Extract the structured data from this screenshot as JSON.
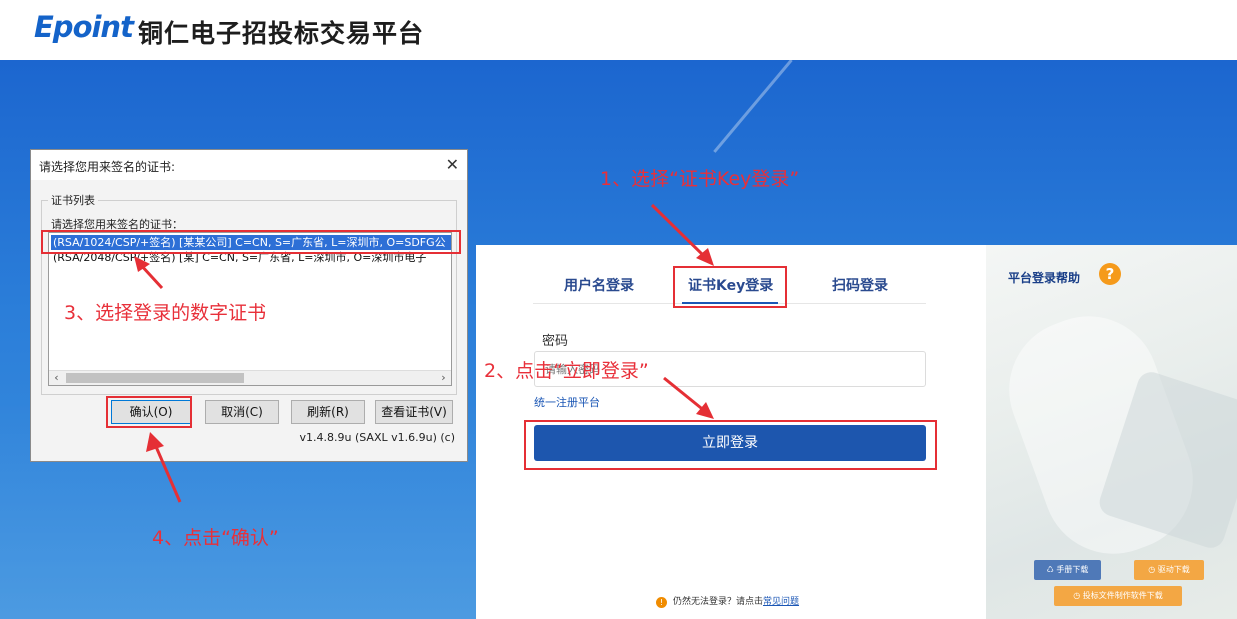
{
  "header": {
    "logo": "Epoint",
    "site_title": "铜仁电子招投标交易平台"
  },
  "cert_dialog": {
    "title": "请选择您用来签名的证书:",
    "group_label": "证书列表",
    "hint": "请选择您用来签名的证书：",
    "certificates": [
      "(RSA/1024/CSP/+签名) [某某公司] C=CN, S=广东省, L=深圳市, O=SDFG公",
      "(RSA/2048/CSP/+签名) [某] C=CN, S=广东省, L=深圳市, O=深圳市电子"
    ],
    "buttons": {
      "ok": "确认(O)",
      "cancel": "取消(C)",
      "refresh": "刷新(R)",
      "view": "查看证书(V)"
    },
    "version": "v1.4.8.9u (SAXL v1.6.9u) (c)"
  },
  "login": {
    "tabs": [
      "用户名登录",
      "证书Key登录",
      "扫码登录"
    ],
    "active_tab": "证书Key登录",
    "password_label": "密码",
    "password_placeholder": "请输入密码",
    "register_link": "统一注册平台",
    "login_button": "立即登录",
    "footer_text": "仍然无法登录？请点击",
    "footer_link": "常见问题"
  },
  "help": {
    "title": "平台登录帮助",
    "icon": "?",
    "manual_download": "手册下载",
    "driver_download": "驱动下载",
    "tool_download": "投标文件制作软件下载"
  },
  "annotations": {
    "step1": "1、选择“证书Key登录”",
    "step2": "2、点击“立即登录”",
    "step3": "3、选择登录的数字证书",
    "step4": "4、点击“确认”"
  },
  "colors": {
    "background_blue": "#2b7ed9",
    "annotation_red": "#e8303a",
    "login_button": "#1d56ae",
    "help_orange": "#f59a1b"
  }
}
